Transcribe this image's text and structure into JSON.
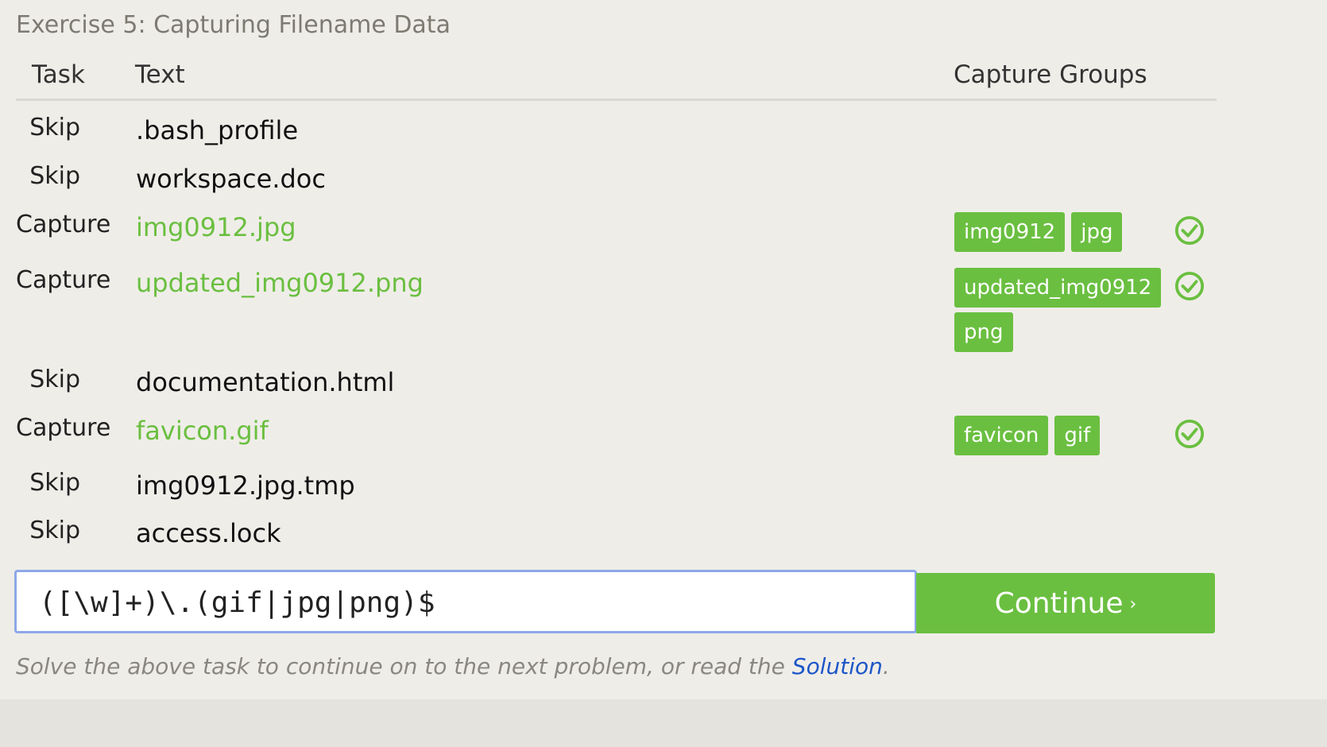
{
  "exercise_title": "Exercise 5: Capturing Filename Data",
  "table": {
    "headers": {
      "task": "Task",
      "text": "Text",
      "groups": "Capture Groups"
    },
    "rows": [
      {
        "task": "Skip",
        "text": ".bash_profile",
        "groups": [],
        "status": ""
      },
      {
        "task": "Skip",
        "text": "workspace.doc",
        "groups": [],
        "status": ""
      },
      {
        "task": "Capture",
        "text": "img0912.jpg",
        "groups": [
          "img0912",
          "jpg"
        ],
        "status": "check-icon"
      },
      {
        "task": "Capture",
        "text": "updated_img0912.png",
        "groups": [
          "updated_img0912",
          "png"
        ],
        "status": "check-icon"
      },
      {
        "task": "Skip",
        "text": "documentation.html",
        "groups": [],
        "status": ""
      },
      {
        "task": "Capture",
        "text": "favicon.gif",
        "groups": [
          "favicon",
          "gif"
        ],
        "status": "check-icon"
      },
      {
        "task": "Skip",
        "text": "img0912.jpg.tmp",
        "groups": [],
        "status": ""
      },
      {
        "task": "Skip",
        "text": "access.lock",
        "groups": [],
        "status": ""
      }
    ]
  },
  "regex_input": {
    "value": "([\\w]+)\\.(gif|jpg|png)$"
  },
  "continue_button": {
    "label": "Continue",
    "chevron": "›"
  },
  "footnote": {
    "prefix": "Solve the above task to continue on to the next problem, or read the ",
    "link": "Solution",
    "suffix": "."
  },
  "colors": {
    "background": "#efede8",
    "accent_green": "#6abf40",
    "link_blue": "#1d56c8",
    "input_border": "#8ca8e8"
  }
}
